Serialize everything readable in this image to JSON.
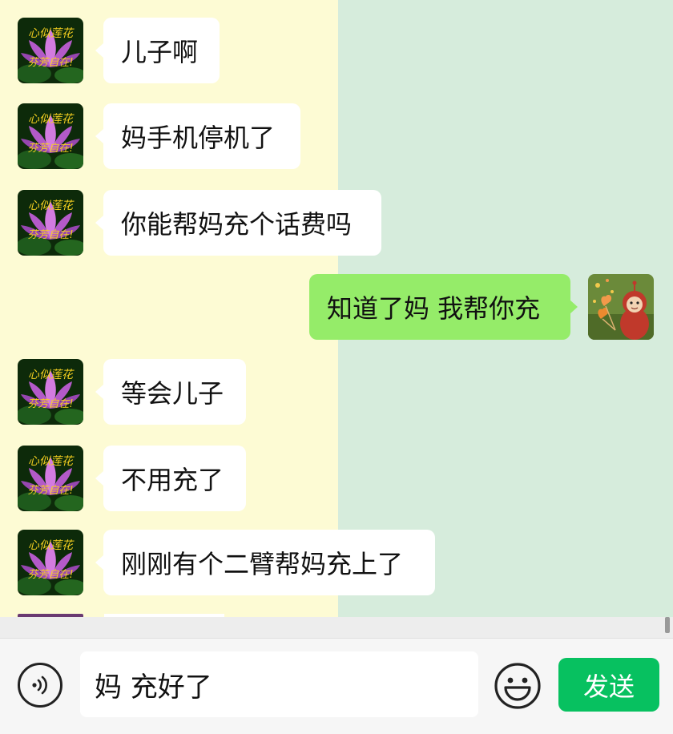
{
  "chat": {
    "messages": [
      {
        "side": "in",
        "text": "儿子啊"
      },
      {
        "side": "in",
        "text": "妈手机停机了"
      },
      {
        "side": "in",
        "text": "你能帮妈充个话费吗"
      },
      {
        "side": "out",
        "text": "知道了妈  我帮你充"
      },
      {
        "side": "in",
        "text": "等会儿子"
      },
      {
        "side": "in",
        "text": "不用充了"
      },
      {
        "side": "in",
        "text": "刚刚有个二臂帮妈充上了"
      }
    ],
    "avatar_caption_top": "心似莲花",
    "avatar_caption_bottom": "芬芳自在!"
  },
  "composer": {
    "input_value": "妈 充好了",
    "send_label": "发送",
    "voice_icon": "voice-icon",
    "emoji_icon": "emoji-icon"
  },
  "colors": {
    "left_bg": "#fdfbd4",
    "right_bg": "#d6ecdc",
    "outgoing_bubble": "#95ec69",
    "send_button": "#07c160"
  }
}
